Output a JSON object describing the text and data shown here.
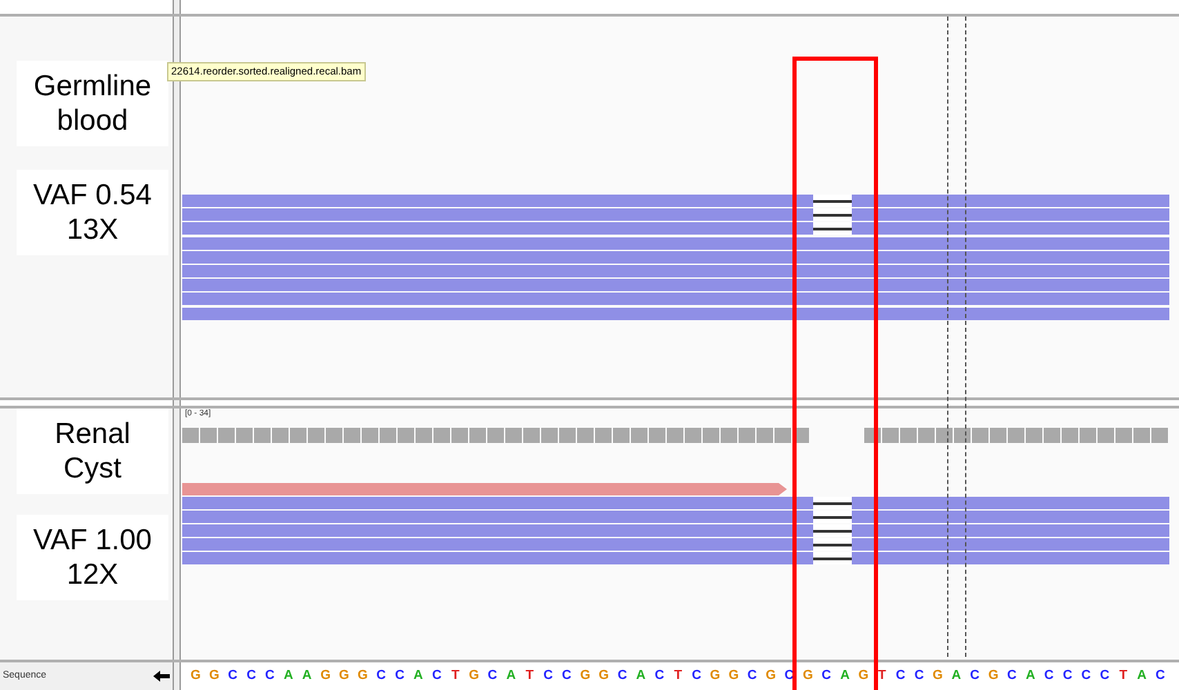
{
  "tooltip": "22614.reorder.sorted.realigned.recal.bam",
  "tracks": [
    {
      "name": [
        "Germline",
        "blood"
      ],
      "stats": [
        "VAF 0.54",
        "13X"
      ],
      "reads": [
        {
          "color": "#8f8fe6",
          "deletion": true
        },
        {
          "color": "#8f8fe6",
          "deletion": true
        },
        {
          "color": "#8f8fe6",
          "deletion": true
        },
        {
          "color": "#8f8fe6",
          "deletion": false
        },
        {
          "color": "#8f8fe6",
          "deletion": false
        },
        {
          "color": "#8f8fe6",
          "deletion": false
        },
        {
          "color": "#8f8fe6",
          "deletion": false
        },
        {
          "color": "#8f8fe6",
          "deletion": false
        },
        {
          "color": "#8f8fe6",
          "deletion": false
        }
      ]
    },
    {
      "name": [
        "Renal",
        "Cyst"
      ],
      "stats": [
        "VAF 1.00",
        "12X"
      ],
      "coverage_range": "[0 - 34]",
      "reads": [
        {
          "color": "#e89494",
          "kind": "partial"
        },
        {
          "color": "#8f8fe6",
          "deletion": true
        },
        {
          "color": "#8f8fe6",
          "deletion": true
        },
        {
          "color": "#8f8fe6",
          "deletion": true
        },
        {
          "color": "#8f8fe6",
          "deletion": true
        },
        {
          "color": "#8f8fe6",
          "deletion": true
        }
      ]
    }
  ],
  "sequence": {
    "label": "Sequence",
    "bases": [
      {
        "base": "G",
        "color": "#e08a00"
      },
      {
        "base": "G",
        "color": "#e08a00"
      },
      {
        "base": "C",
        "color": "#2424ff"
      },
      {
        "base": "C",
        "color": "#2424ff"
      },
      {
        "base": "C",
        "color": "#2424ff"
      },
      {
        "base": "A",
        "color": "#22b022"
      },
      {
        "base": "A",
        "color": "#22b022"
      },
      {
        "base": "G",
        "color": "#e08a00"
      },
      {
        "base": "G",
        "color": "#e08a00"
      },
      {
        "base": "G",
        "color": "#e08a00"
      },
      {
        "base": "C",
        "color": "#2424ff"
      },
      {
        "base": "C",
        "color": "#2424ff"
      },
      {
        "base": "A",
        "color": "#22b022"
      },
      {
        "base": "C",
        "color": "#2424ff"
      },
      {
        "base": "T",
        "color": "#e02020"
      },
      {
        "base": "G",
        "color": "#e08a00"
      },
      {
        "base": "C",
        "color": "#2424ff"
      },
      {
        "base": "A",
        "color": "#22b022"
      },
      {
        "base": "T",
        "color": "#e02020"
      },
      {
        "base": "C",
        "color": "#2424ff"
      },
      {
        "base": "C",
        "color": "#2424ff"
      },
      {
        "base": "G",
        "color": "#e08a00"
      },
      {
        "base": "G",
        "color": "#e08a00"
      },
      {
        "base": "C",
        "color": "#2424ff"
      },
      {
        "base": "A",
        "color": "#22b022"
      },
      {
        "base": "C",
        "color": "#2424ff"
      },
      {
        "base": "T",
        "color": "#e02020"
      },
      {
        "base": "C",
        "color": "#2424ff"
      },
      {
        "base": "G",
        "color": "#e08a00"
      },
      {
        "base": "G",
        "color": "#e08a00"
      },
      {
        "base": "C",
        "color": "#2424ff"
      },
      {
        "base": "G",
        "color": "#e08a00"
      },
      {
        "base": "C",
        "color": "#2424ff"
      },
      {
        "base": "G",
        "color": "#e08a00"
      },
      {
        "base": "C",
        "color": "#2424ff"
      },
      {
        "base": "A",
        "color": "#22b022"
      },
      {
        "base": "G",
        "color": "#e08a00"
      },
      {
        "base": "T",
        "color": "#e02020"
      },
      {
        "base": "C",
        "color": "#2424ff"
      },
      {
        "base": "C",
        "color": "#2424ff"
      },
      {
        "base": "G",
        "color": "#e08a00"
      },
      {
        "base": "A",
        "color": "#22b022"
      },
      {
        "base": "C",
        "color": "#2424ff"
      },
      {
        "base": "G",
        "color": "#e08a00"
      },
      {
        "base": "C",
        "color": "#2424ff"
      },
      {
        "base": "A",
        "color": "#22b022"
      },
      {
        "base": "C",
        "color": "#2424ff"
      },
      {
        "base": "C",
        "color": "#2424ff"
      },
      {
        "base": "C",
        "color": "#2424ff"
      },
      {
        "base": "C",
        "color": "#2424ff"
      },
      {
        "base": "T",
        "color": "#e02020"
      },
      {
        "base": "A",
        "color": "#22b022"
      },
      {
        "base": "C",
        "color": "#2424ff"
      }
    ]
  }
}
